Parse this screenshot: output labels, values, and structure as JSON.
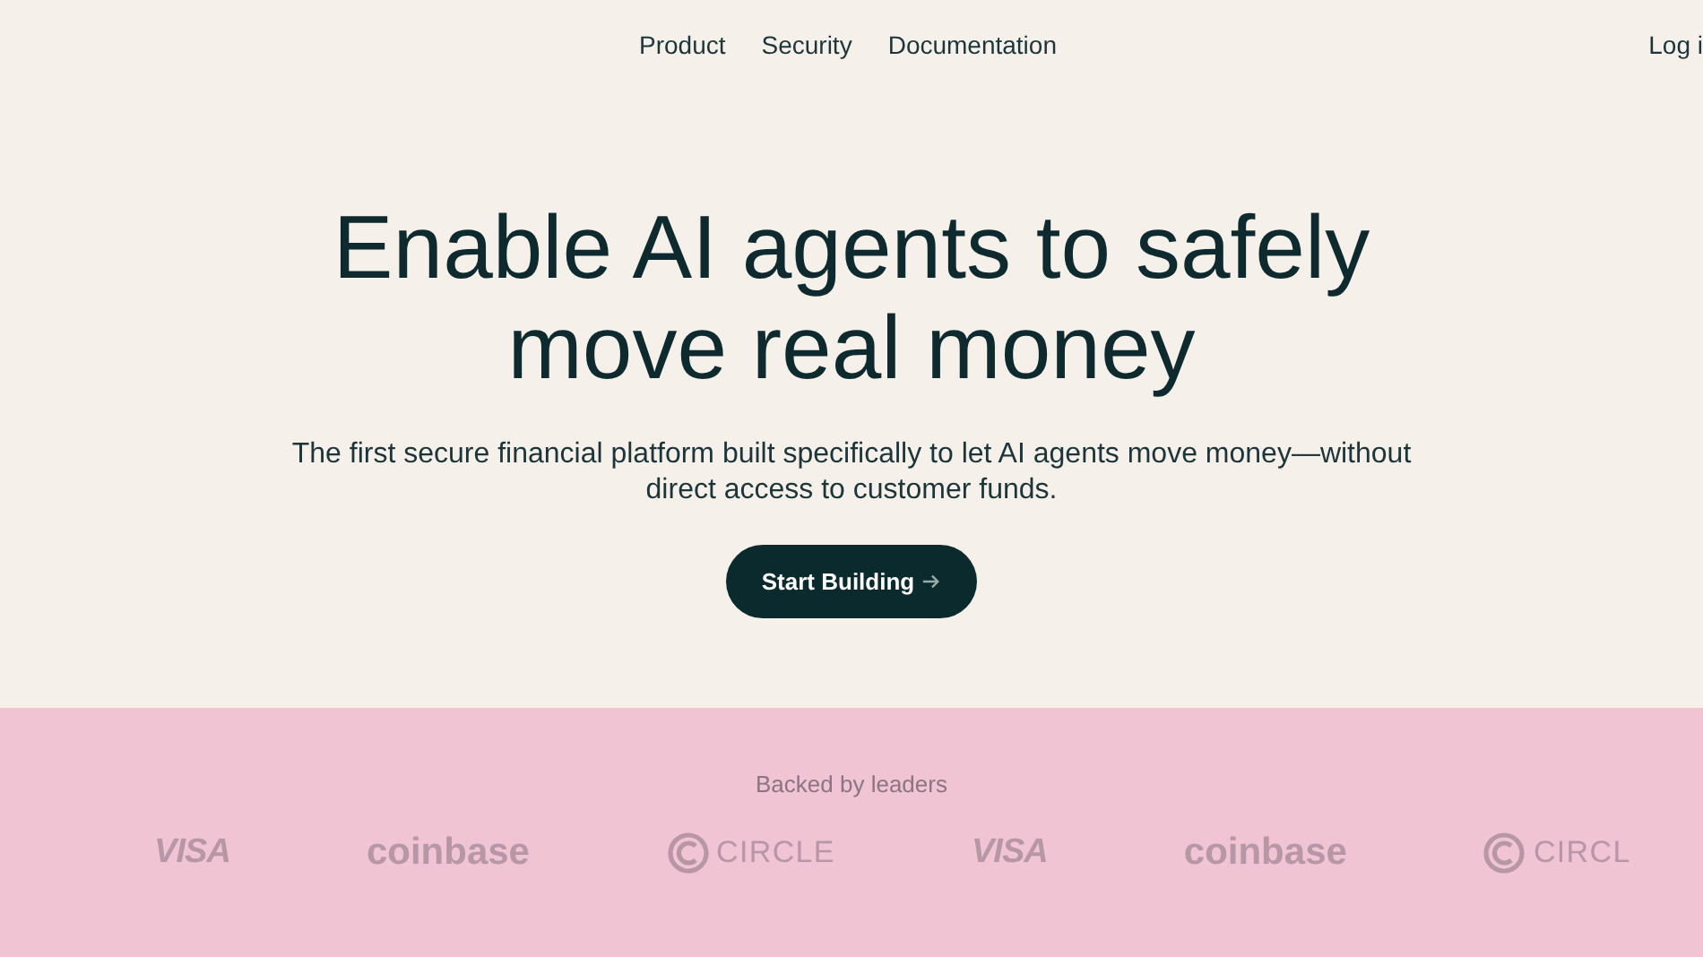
{
  "nav": {
    "links": [
      "Product",
      "Security",
      "Documentation"
    ],
    "login": "Log i"
  },
  "hero": {
    "title": "Enable AI agents to safely move real money",
    "subtitle": "The first secure financial platform built specifically to let AI agents move money—without direct access to customer funds.",
    "cta": "Start Building"
  },
  "backers": {
    "heading": "Backed by leaders",
    "logos": [
      {
        "kind": "visa",
        "name": "VISA"
      },
      {
        "kind": "coinbase",
        "name": "coinbase"
      },
      {
        "kind": "circle",
        "name": "CIRCLE"
      },
      {
        "kind": "visa",
        "name": "VISA"
      },
      {
        "kind": "coinbase",
        "name": "coinbase"
      },
      {
        "kind": "circle",
        "name": "CIRCL"
      }
    ]
  }
}
